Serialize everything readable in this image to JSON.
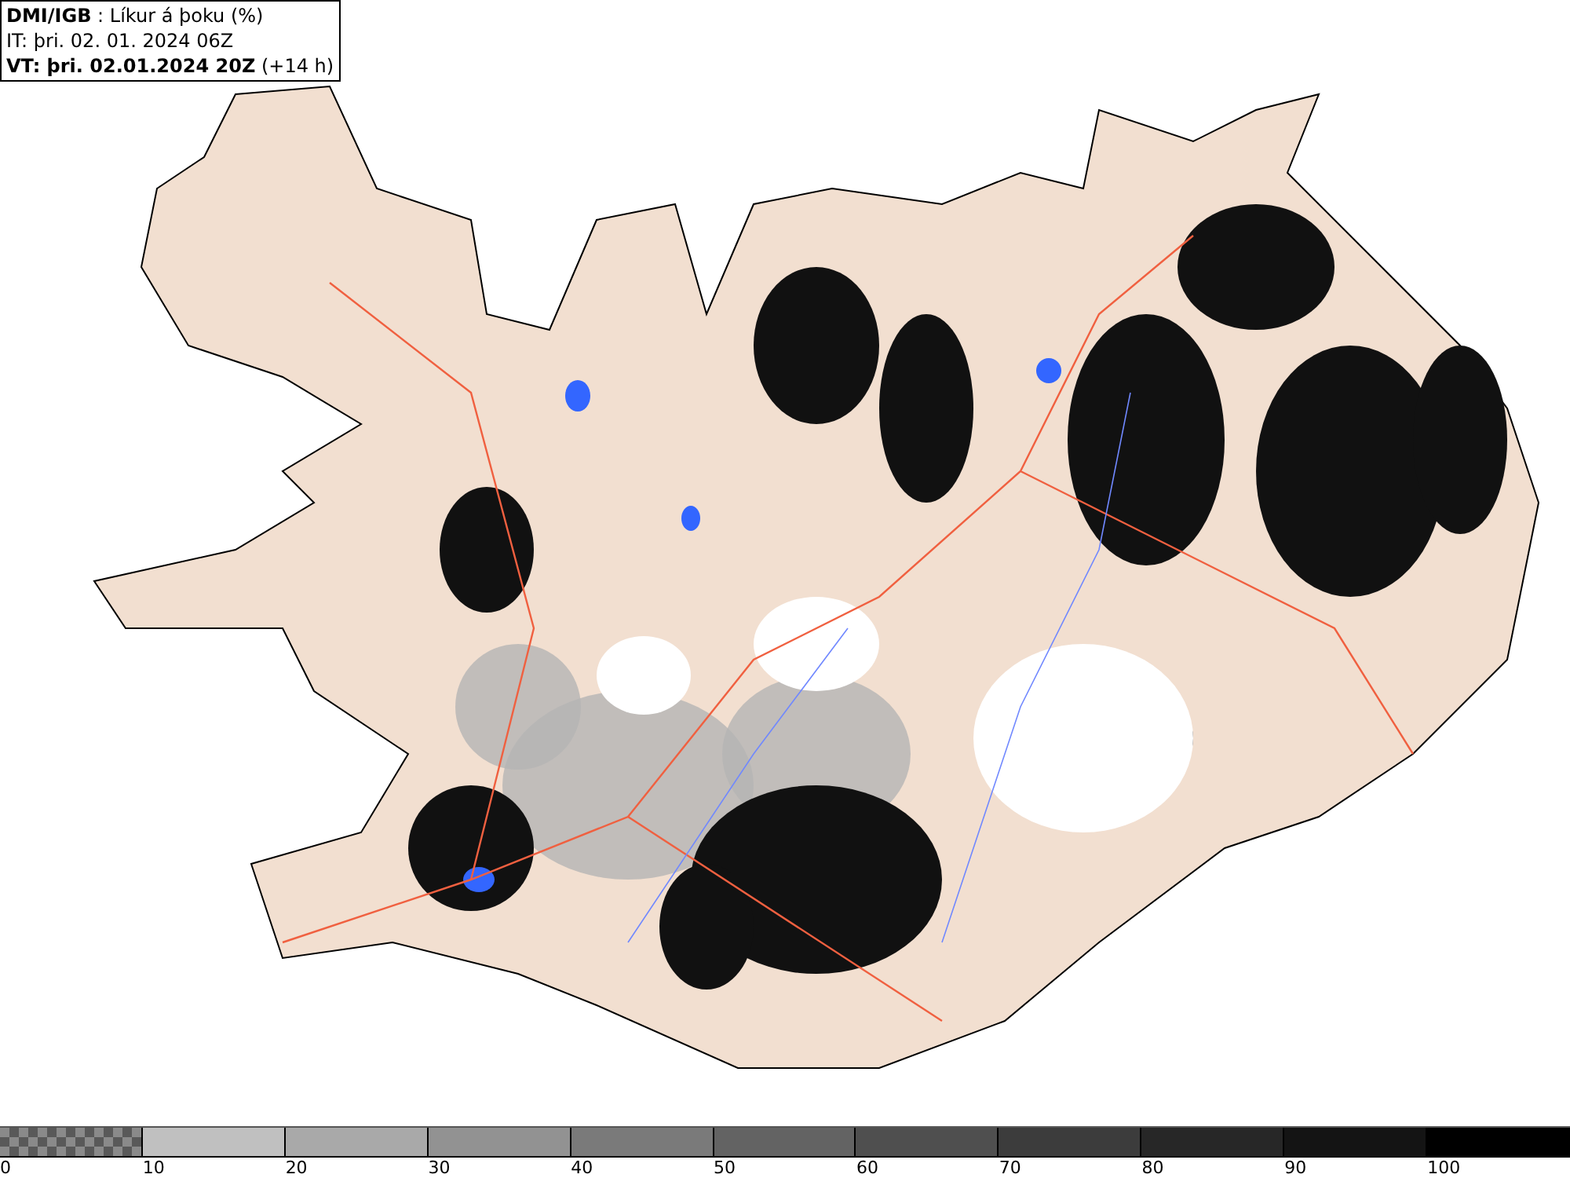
{
  "header": {
    "title": "**DMI/IGB** : Líkur á þoku (%)",
    "issue_time": "IT: þri. 02. 01. 2024 06Z",
    "valid_time": "**VT: þri. 02.01.2024 20Z** (+14 h)"
  },
  "legend": {
    "segments": [
      {
        "kind": "pattern",
        "label": "0"
      },
      {
        "kind": "solid",
        "color": "#c0c0c0",
        "label": "10"
      },
      {
        "kind": "solid",
        "color": "#a9a9a9",
        "label": "20"
      },
      {
        "kind": "solid",
        "color": "#929292",
        "label": "30"
      },
      {
        "kind": "solid",
        "color": "#7a7a7a",
        "label": "40"
      },
      {
        "kind": "solid",
        "color": "#636363",
        "label": "50"
      },
      {
        "kind": "solid",
        "color": "#4f4f4f",
        "label": "60"
      },
      {
        "kind": "solid",
        "color": "#3c3c3c",
        "label": "70"
      },
      {
        "kind": "solid",
        "color": "#272727",
        "label": "80"
      },
      {
        "kind": "solid",
        "color": "#141414",
        "label": "90"
      },
      {
        "kind": "solid",
        "color": "#000000",
        "label": "100"
      }
    ]
  }
}
